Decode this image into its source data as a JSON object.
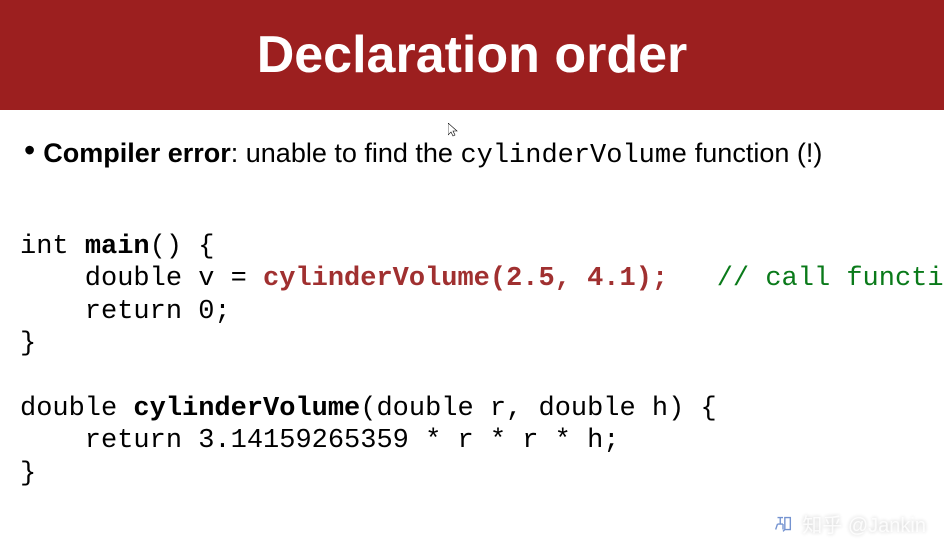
{
  "slide": {
    "title": "Declaration order",
    "bullet": {
      "label_bold": "Compiler error",
      "label_rest": ": unable to find the ",
      "code_id": "cylinderVolume",
      "label_suffix": " function (!)"
    },
    "code": {
      "line1_pre": "int ",
      "line1_bold": "main",
      "line1_post": "() {",
      "line2_pre": "    double v = ",
      "line2_call": "cylinderVolume(2.5, 4.1);",
      "line2_spacer": "   ",
      "line2_comment": "// call function",
      "line3": "    return 0;",
      "line4": "}",
      "blank": "",
      "line5_pre": "double ",
      "line5_bold": "cylinderVolume",
      "line5_post": "(double r, double h) {",
      "line6": "    return 3.14159265359 * r * r * h;",
      "line7": "}"
    }
  },
  "watermark": {
    "text": "知乎 @Jankin"
  }
}
